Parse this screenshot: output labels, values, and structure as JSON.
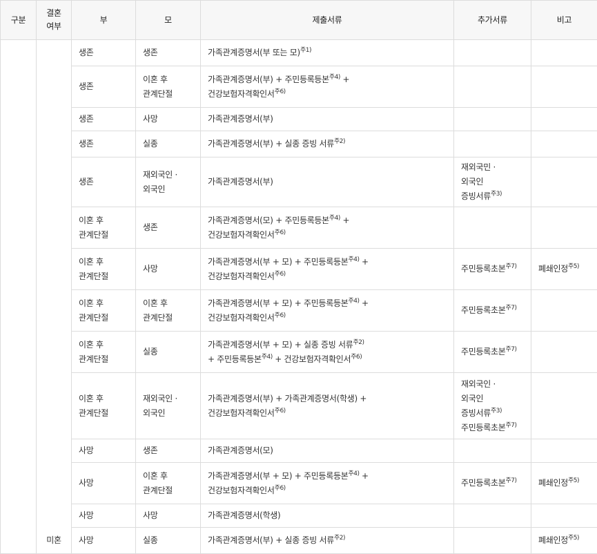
{
  "headers": {
    "category": "구분",
    "marriage_line1": "결혼",
    "marriage_line2": "여부",
    "father": "부",
    "mother": "모",
    "documents": "제출서류",
    "additional": "추가서류",
    "remarks": "비고"
  },
  "marriage_status": "미혼",
  "rows": [
    {
      "father": [
        "생존"
      ],
      "mother": [
        "생존"
      ],
      "docs": [
        [
          {
            "t": "가족관계증명서(부 또는 모)"
          },
          {
            "s": "주1)"
          }
        ]
      ],
      "extra": [],
      "remark": []
    },
    {
      "father": [
        "생존"
      ],
      "mother": [
        "이혼 후",
        "관계단절"
      ],
      "docs": [
        [
          {
            "t": "가족관계증명서(부) + 주민등록등본"
          },
          {
            "s": "주4)"
          },
          {
            "t": " +"
          }
        ],
        [
          {
            "t": "건강보험자격확인서"
          },
          {
            "s": "주6)"
          }
        ]
      ],
      "extra": [],
      "remark": []
    },
    {
      "father": [
        "생존"
      ],
      "mother": [
        "사망"
      ],
      "docs": [
        [
          {
            "t": "가족관계증명서(부)"
          }
        ]
      ],
      "extra": [],
      "remark": []
    },
    {
      "father": [
        "생존"
      ],
      "mother": [
        "실종"
      ],
      "docs": [
        [
          {
            "t": "가족관계증명서(부) + 실종 증빙 서류"
          },
          {
            "s": "주2)"
          }
        ]
      ],
      "extra": [],
      "remark": []
    },
    {
      "father": [
        "생존"
      ],
      "mother": [
        "재외국인 ·",
        "외국인"
      ],
      "docs": [
        [
          {
            "t": "가족관계증명서(부)"
          }
        ]
      ],
      "extra": [
        [
          {
            "t": "재외국민 ·"
          }
        ],
        [
          {
            "t": "외국인"
          }
        ],
        [
          {
            "t": "증빙서류"
          },
          {
            "s": "주3)"
          }
        ]
      ],
      "remark": []
    },
    {
      "father": [
        "이혼 후",
        "관계단절"
      ],
      "mother": [
        "생존"
      ],
      "docs": [
        [
          {
            "t": "가족관계증명서(모) + 주민등록등본"
          },
          {
            "s": "주4)"
          },
          {
            "t": " +"
          }
        ],
        [
          {
            "t": "건강보험자격확인서"
          },
          {
            "s": "주6)"
          }
        ]
      ],
      "extra": [],
      "remark": []
    },
    {
      "father": [
        "이혼 후",
        "관계단절"
      ],
      "mother": [
        "사망"
      ],
      "docs": [
        [
          {
            "t": "가족관계증명서(부 + 모) + 주민등록등본"
          },
          {
            "s": "주4)"
          },
          {
            "t": " +"
          }
        ],
        [
          {
            "t": "건강보험자격확인서"
          },
          {
            "s": "주6)"
          }
        ]
      ],
      "extra": [
        [
          {
            "t": "주민등록초본"
          },
          {
            "s": "주7)"
          }
        ]
      ],
      "remark": [
        [
          {
            "t": "폐쇄인정"
          },
          {
            "s": "주5)"
          }
        ]
      ]
    },
    {
      "father": [
        "이혼 후",
        "관계단절"
      ],
      "mother": [
        "이혼 후",
        "관계단절"
      ],
      "docs": [
        [
          {
            "t": "가족관계증명서(부 + 모) + 주민등록등본"
          },
          {
            "s": "주4)"
          },
          {
            "t": " +"
          }
        ],
        [
          {
            "t": "건강보험자격확인서"
          },
          {
            "s": "주6)"
          }
        ]
      ],
      "extra": [
        [
          {
            "t": "주민등록초본"
          },
          {
            "s": "주7)"
          }
        ]
      ],
      "remark": []
    },
    {
      "father": [
        "이혼 후",
        "관계단절"
      ],
      "mother": [
        "실종"
      ],
      "docs": [
        [
          {
            "t": "가족관계증명서(부 + 모) + 실종 증빙 서류"
          },
          {
            "s": "주2)"
          }
        ],
        [
          {
            "t": "+ 주민등록등본"
          },
          {
            "s": "주4)"
          },
          {
            "t": " + 건강보험자격확인서"
          },
          {
            "s": "주6)"
          }
        ]
      ],
      "extra": [
        [
          {
            "t": "주민등록초본"
          },
          {
            "s": "주7)"
          }
        ]
      ],
      "remark": []
    },
    {
      "father": [
        "이혼 후",
        "관계단절"
      ],
      "mother": [
        "재외국인 ·",
        "외국인"
      ],
      "docs": [
        [
          {
            "t": "가족관계증명서(부) + 가족관계증명서(학생) +"
          }
        ],
        [
          {
            "t": "건강보험자격확인서"
          },
          {
            "s": "주6)"
          }
        ]
      ],
      "extra": [
        [
          {
            "t": "재외국인 ·"
          }
        ],
        [
          {
            "t": "외국인"
          }
        ],
        [
          {
            "t": "증빙서류"
          },
          {
            "s": "주3)"
          }
        ],
        [
          {
            "t": "주민등록초본"
          },
          {
            "s": "주7)"
          }
        ]
      ],
      "remark": []
    },
    {
      "father": [
        "사망"
      ],
      "mother": [
        "생존"
      ],
      "docs": [
        [
          {
            "t": "가족관계증명서(모)"
          }
        ]
      ],
      "extra": [],
      "remark": []
    },
    {
      "father": [
        "사망"
      ],
      "mother": [
        "이혼 후",
        "관계단절"
      ],
      "docs": [
        [
          {
            "t": "가족관계증명서(부 + 모) + 주민등록등본"
          },
          {
            "s": "주4)"
          },
          {
            "t": " +"
          }
        ],
        [
          {
            "t": "건강보험자격확인서"
          },
          {
            "s": "주6)"
          }
        ]
      ],
      "extra": [
        [
          {
            "t": "주민등록초본"
          },
          {
            "s": "주7)"
          }
        ]
      ],
      "remark": [
        [
          {
            "t": "폐쇄인정"
          },
          {
            "s": "주5)"
          }
        ]
      ]
    },
    {
      "father": [
        "사망"
      ],
      "mother": [
        "사망"
      ],
      "docs": [
        [
          {
            "t": "가족관계증명서(학생)"
          }
        ]
      ],
      "extra": [],
      "remark": []
    },
    {
      "father": [
        "사망"
      ],
      "mother": [
        "실종"
      ],
      "docs": [
        [
          {
            "t": "가족관계증명서(부) + 실종 증빙 서류"
          },
          {
            "s": "주2)"
          }
        ]
      ],
      "extra": [],
      "remark": [
        [
          {
            "t": "폐쇄인정"
          },
          {
            "s": "주5)"
          }
        ]
      ]
    }
  ]
}
